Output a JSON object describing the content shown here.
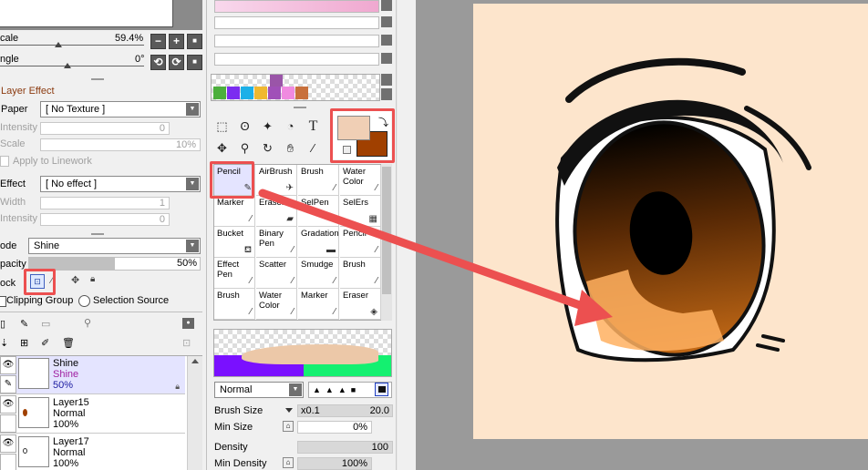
{
  "view": {
    "scale_label": "cale",
    "scale_value": "59.4%",
    "angle_label": "ngle",
    "angle_value": "0°"
  },
  "layer_effect": {
    "title": "Layer Effect",
    "paper_label": "Paper",
    "paper_value": "[ No Texture ]",
    "intensity_label": "Intensity",
    "intensity_value": "0",
    "scale_label": "Scale",
    "scale_value": "10%",
    "apply_linework": "Apply to Linework",
    "effect_label": "Effect",
    "effect_value": "[ No effect ]",
    "width_label": "Width",
    "width_value": "1",
    "intensity2_label": "Intensity",
    "intensity2_value": "0"
  },
  "layer_props": {
    "mode_label": "ode",
    "mode_value": "Shine",
    "opacity_label": "pacity",
    "opacity_value": "50%",
    "opacity_fraction": 0.5,
    "lock_label": "ock",
    "clipping_group": "Clipping Group",
    "selection_source": "Selection Source"
  },
  "layers": [
    {
      "name": "Shine",
      "mode": "Shine",
      "opacity": "50%",
      "selected": true
    },
    {
      "name": "Layer15",
      "mode": "Normal",
      "opacity": "100%",
      "selected": false
    },
    {
      "name": "Layer17",
      "mode": "Normal",
      "opacity": "100%",
      "selected": false
    }
  ],
  "tools": {
    "text_tool": "T"
  },
  "swatches": [
    "#4caf3c",
    "#7b2cf0",
    "#1cb0e8",
    "#f0b830",
    "#a050b8",
    "#f08ae0",
    "#c8703c",
    "#9a55a8"
  ],
  "colors": {
    "primary": "#f0cfb5",
    "secondary": "#a04000",
    "accent_red": "#ec5050"
  },
  "brushes": [
    [
      "Pencil",
      "AirBrush",
      "Brush",
      "Water Color"
    ],
    [
      "Marker",
      "Eraser",
      "SelPen",
      "SelErs"
    ],
    [
      "Bucket",
      "Binary Pen",
      "Gradation",
      "Pencil"
    ],
    [
      "Effect Pen",
      "Scatter",
      "Smudge",
      "Brush"
    ],
    [
      "Brush",
      "Water Color",
      "Marker",
      "Eraser"
    ]
  ],
  "brush_settings": {
    "blend_mode": "Normal",
    "brush_size_label": "Brush Size",
    "brush_size_mult": "x0.1",
    "brush_size_value": "20.0",
    "min_size_label": "Min Size",
    "min_size_value": "0%",
    "density_label": "Density",
    "density_value": "100",
    "min_density_label": "Min Density",
    "min_density_value": "100%"
  }
}
